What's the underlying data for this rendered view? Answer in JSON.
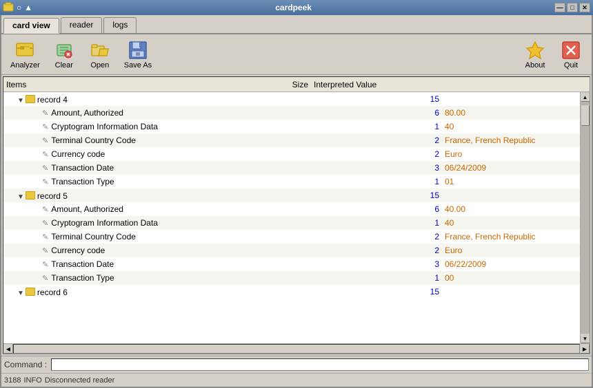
{
  "titlebar": {
    "title": "cardpeek",
    "minimize": "—",
    "maximize": "□",
    "close": "✕"
  },
  "tabs": [
    {
      "label": "card view",
      "active": true
    },
    {
      "label": "reader",
      "active": false
    },
    {
      "label": "logs",
      "active": false
    }
  ],
  "toolbar": {
    "analyzer_label": "Analyzer",
    "clear_label": "Clear",
    "open_label": "Open",
    "saveas_label": "Save As",
    "about_label": "About",
    "quit_label": "Quit"
  },
  "tree": {
    "header": {
      "items_col": "Items",
      "size_col": "Size",
      "value_col": "Interpreted Value"
    },
    "rows": [
      {
        "type": "record",
        "indent": 1,
        "label": "record 4",
        "size": "15",
        "value": ""
      },
      {
        "type": "item",
        "indent": 2,
        "label": "Amount, Authorized",
        "size": "6",
        "value": "80.00"
      },
      {
        "type": "item",
        "indent": 2,
        "label": "Cryptogram Information Data",
        "size": "1",
        "value": "40"
      },
      {
        "type": "item",
        "indent": 2,
        "label": "Terminal Country Code",
        "size": "2",
        "value": "France, French Republic"
      },
      {
        "type": "item",
        "indent": 2,
        "label": "Currency code",
        "size": "2",
        "value": "Euro"
      },
      {
        "type": "item",
        "indent": 2,
        "label": "Transaction Date",
        "size": "3",
        "value": "06/24/2009"
      },
      {
        "type": "item",
        "indent": 2,
        "label": "Transaction Type",
        "size": "1",
        "value": "01"
      },
      {
        "type": "record",
        "indent": 1,
        "label": "record 5",
        "size": "15",
        "value": ""
      },
      {
        "type": "item",
        "indent": 2,
        "label": "Amount, Authorized",
        "size": "6",
        "value": "40.00"
      },
      {
        "type": "item",
        "indent": 2,
        "label": "Cryptogram Information Data",
        "size": "1",
        "value": "40"
      },
      {
        "type": "item",
        "indent": 2,
        "label": "Terminal Country Code",
        "size": "2",
        "value": "France, French Republic"
      },
      {
        "type": "item",
        "indent": 2,
        "label": "Currency code",
        "size": "2",
        "value": "Euro"
      },
      {
        "type": "item",
        "indent": 2,
        "label": "Transaction Date",
        "size": "3",
        "value": "06/22/2009"
      },
      {
        "type": "item",
        "indent": 2,
        "label": "Transaction Type",
        "size": "1",
        "value": "00"
      },
      {
        "type": "record",
        "indent": 1,
        "label": "record 6",
        "size": "15",
        "value": ""
      }
    ]
  },
  "bottom": {
    "command_label": "Command :",
    "command_placeholder": "",
    "status_code": "3188",
    "status_level": "INFO",
    "status_text": "Disconnected reader"
  }
}
